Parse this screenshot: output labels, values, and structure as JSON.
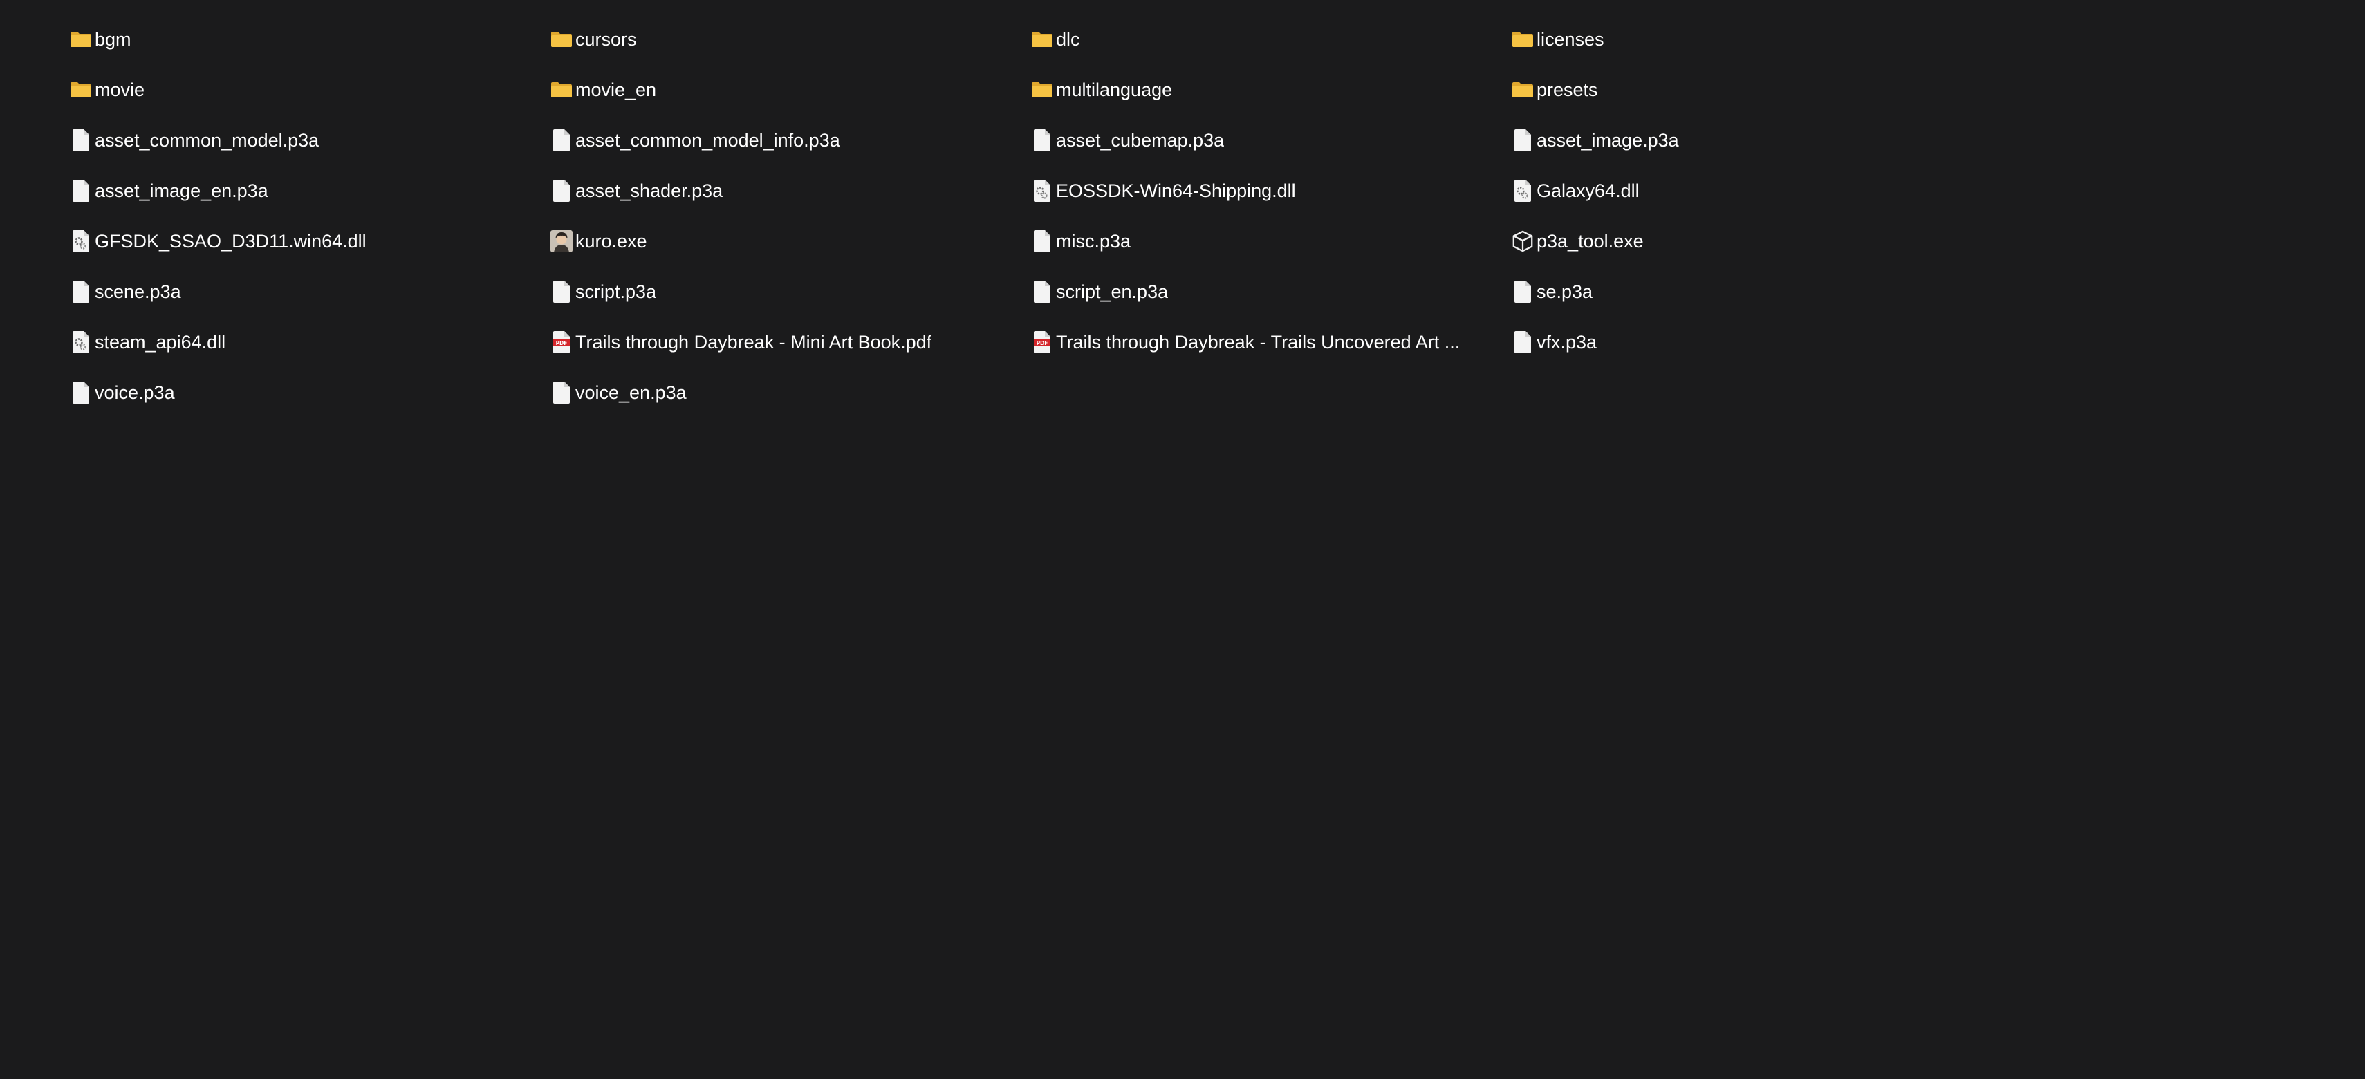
{
  "colors": {
    "background": "#1b1b1c",
    "text": "#ffffff",
    "folder": "#f6c343",
    "folder_dark": "#e0a82e",
    "file": "#f3f3f3",
    "pdf_red": "#d4252a"
  },
  "items": [
    {
      "label": "bgm",
      "icon": "folder-icon"
    },
    {
      "label": "cursors",
      "icon": "folder-icon"
    },
    {
      "label": "dlc",
      "icon": "folder-icon"
    },
    {
      "label": "licenses",
      "icon": "folder-icon"
    },
    {
      "label": "movie",
      "icon": "folder-icon"
    },
    {
      "label": "movie_en",
      "icon": "folder-icon"
    },
    {
      "label": "multilanguage",
      "icon": "folder-icon"
    },
    {
      "label": "presets",
      "icon": "folder-icon"
    },
    {
      "label": "asset_common_model.p3a",
      "icon": "file-icon"
    },
    {
      "label": "asset_common_model_info.p3a",
      "icon": "file-icon"
    },
    {
      "label": "asset_cubemap.p3a",
      "icon": "file-icon"
    },
    {
      "label": "asset_image.p3a",
      "icon": "file-icon"
    },
    {
      "label": "asset_image_en.p3a",
      "icon": "file-icon"
    },
    {
      "label": "asset_shader.p3a",
      "icon": "file-icon"
    },
    {
      "label": "EOSSDK-Win64-Shipping.dll",
      "icon": "dll-icon"
    },
    {
      "label": "Galaxy64.dll",
      "icon": "dll-icon"
    },
    {
      "label": "GFSDK_SSAO_D3D11.win64.dll",
      "icon": "dll-icon"
    },
    {
      "label": "kuro.exe",
      "icon": "app-portrait-icon"
    },
    {
      "label": "misc.p3a",
      "icon": "file-icon"
    },
    {
      "label": "p3a_tool.exe",
      "icon": "exe-box-icon"
    },
    {
      "label": "scene.p3a",
      "icon": "file-icon"
    },
    {
      "label": "script.p3a",
      "icon": "file-icon"
    },
    {
      "label": "script_en.p3a",
      "icon": "file-icon"
    },
    {
      "label": "se.p3a",
      "icon": "file-icon"
    },
    {
      "label": "steam_api64.dll",
      "icon": "dll-icon"
    },
    {
      "label": "Trails through Daybreak - Mini Art Book.pdf",
      "icon": "pdf-icon"
    },
    {
      "label": "Trails through Daybreak - Trails Uncovered Art ...",
      "icon": "pdf-icon"
    },
    {
      "label": "vfx.p3a",
      "icon": "file-icon"
    },
    {
      "label": "voice.p3a",
      "icon": "file-icon"
    },
    {
      "label": "voice_en.p3a",
      "icon": "file-icon"
    }
  ]
}
